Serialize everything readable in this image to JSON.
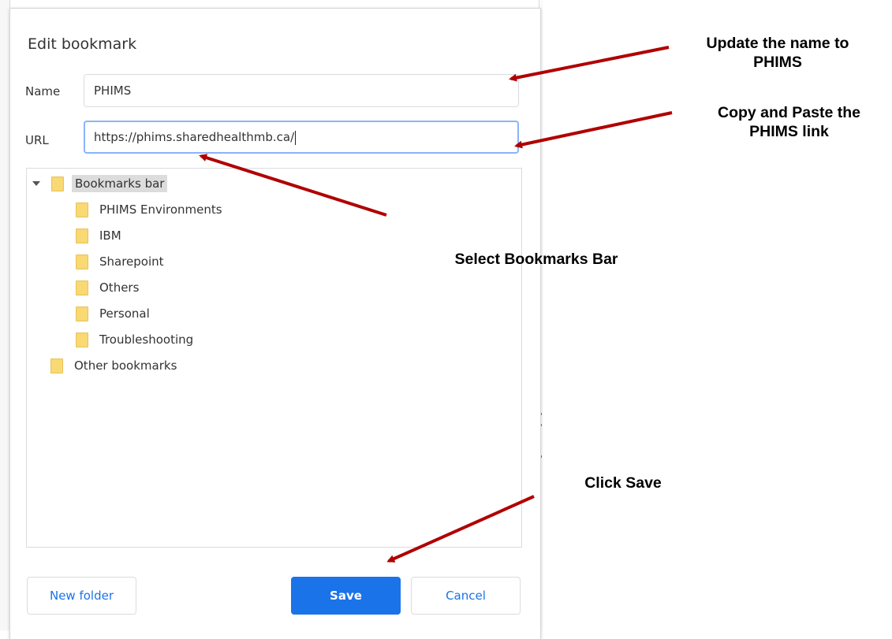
{
  "dialog": {
    "title": "Edit bookmark",
    "name_label": "Name",
    "name_value": "PHIMS",
    "url_label": "URL",
    "url_value": "https://phims.sharedhealthmb.ca/",
    "tree": {
      "root": "Bookmarks bar",
      "children": [
        "PHIMS Environments",
        "IBM",
        "Sharepoint",
        "Others",
        "Personal",
        "Troubleshooting"
      ],
      "other": "Other bookmarks"
    },
    "buttons": {
      "new_folder": "New folder",
      "save": "Save",
      "cancel": "Cancel"
    }
  },
  "annotations": {
    "name_line1": "Update the name to",
    "name_line2": "PHIMS",
    "url_line1": "Copy and Paste the",
    "url_line2": "PHIMS link",
    "folder": "Select Bookmarks Bar",
    "save": "Click Save"
  },
  "colors": {
    "accent": "#1a73e8",
    "arrow": "#b00000",
    "folder": "#f9d973"
  }
}
